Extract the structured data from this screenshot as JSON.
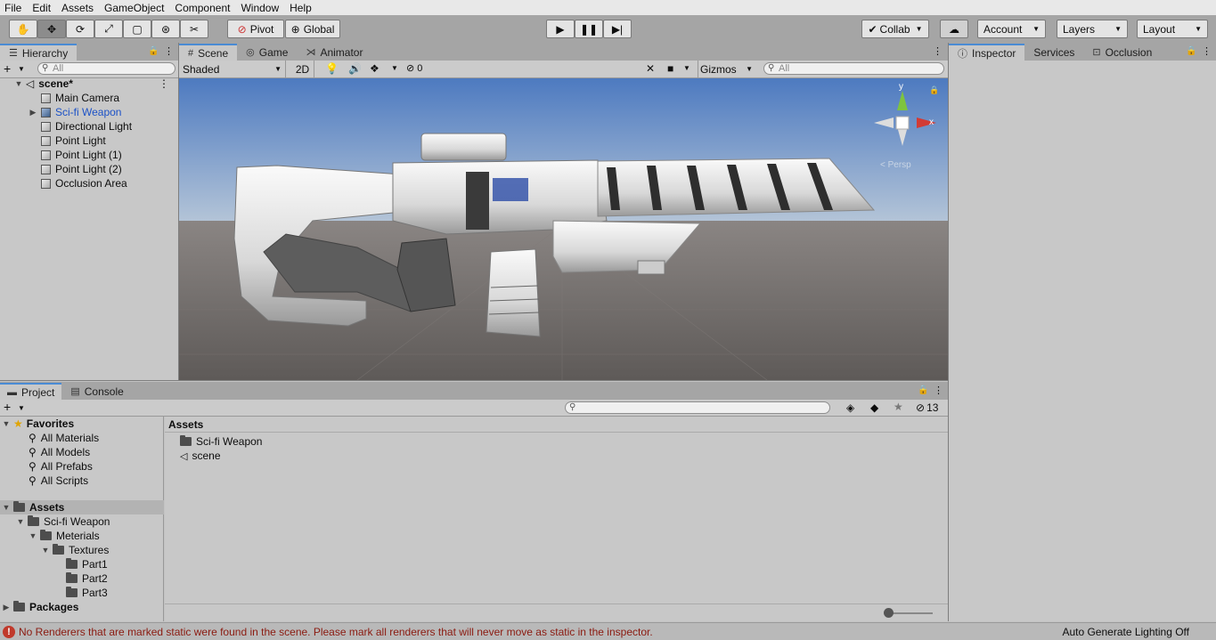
{
  "menu": [
    "File",
    "Edit",
    "Assets",
    "GameObject",
    "Component",
    "Window",
    "Help"
  ],
  "toolbar": {
    "pivot": "Pivot",
    "global": "Global",
    "collab": "Collab",
    "account": "Account",
    "layers": "Layers",
    "layout": "Layout"
  },
  "hierarchy": {
    "tab": "Hierarchy",
    "search_placeholder": "All",
    "scene": "scene*",
    "items": [
      "Main Camera",
      "Sci-fi Weapon",
      "Directional Light",
      "Point Light",
      "Point Light (1)",
      "Point Light (2)",
      "Occlusion Area"
    ]
  },
  "scene_tabs": [
    "Scene",
    "Game",
    "Animator"
  ],
  "scene_bar": {
    "shading": "Shaded",
    "mode_2d": "2D",
    "hidden_count": "0",
    "gizmos": "Gizmos",
    "search_placeholder": "All",
    "persp": "< Persp"
  },
  "gizmo_axes": {
    "y": "y",
    "x": "x"
  },
  "right_tabs": [
    "Inspector",
    "Services",
    "Occlusion"
  ],
  "bottom_tabs": [
    "Project",
    "Console"
  ],
  "project": {
    "hidden_count": "13",
    "favorites_label": "Favorites",
    "favorites": [
      "All Materials",
      "All Models",
      "All Prefabs",
      "All Scripts"
    ],
    "assets_label": "Assets",
    "tree": [
      {
        "label": "Sci-fi Weapon",
        "depth": 1
      },
      {
        "label": "Meterials",
        "depth": 2
      },
      {
        "label": "Textures",
        "depth": 3
      },
      {
        "label": "Part1",
        "depth": 4
      },
      {
        "label": "Part2",
        "depth": 4
      },
      {
        "label": "Part3",
        "depth": 4
      }
    ],
    "packages_label": "Packages",
    "breadcrumb": "Assets",
    "files": [
      "Sci-fi Weapon",
      "scene"
    ]
  },
  "status": {
    "message": "No Renderers that are marked static were found in the scene. Please mark all renderers that will never move as static in the inspector.",
    "lighting": "Auto Generate Lighting Off"
  },
  "colors": {
    "accent": "#4a8bd4",
    "selected_text": "#1c52c7",
    "error": "#c0392b",
    "sky_top": "#5c87c4",
    "ground": "#6f6b69"
  }
}
